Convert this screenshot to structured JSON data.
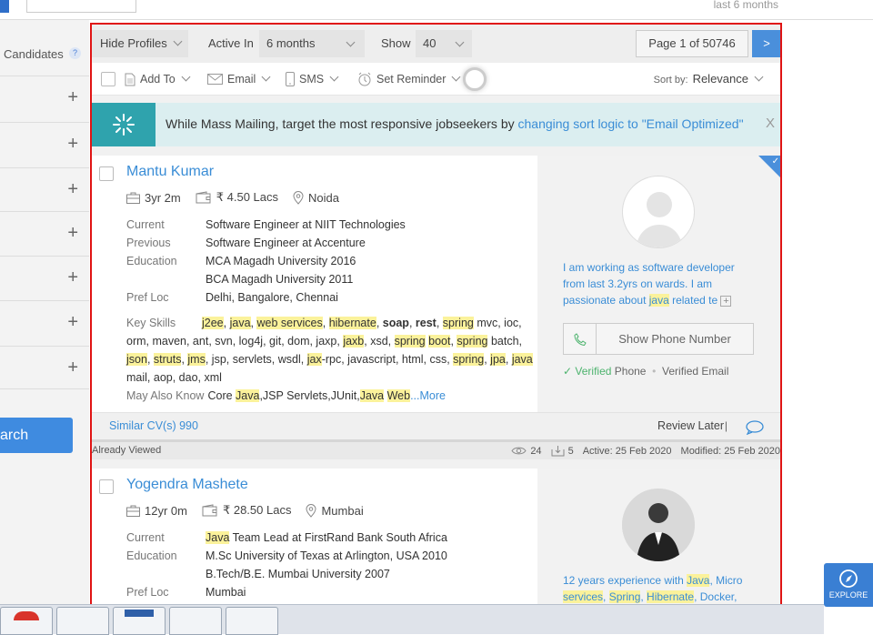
{
  "topbar": {
    "last_label": "last 6 months"
  },
  "sidebar": {
    "candidates_label": "Candidates",
    "help_glyph": "?",
    "rows": [
      "+",
      "+",
      "+",
      "+",
      "+",
      "+",
      "+"
    ],
    "search_label": "arch"
  },
  "filters": {
    "hide_profiles": "Hide Profiles",
    "active_in_label": "Active In",
    "active_in_value": "6 months",
    "show_label": "Show",
    "show_value": "40",
    "page_info": "Page 1 of 50746",
    "next_label": ">"
  },
  "actions": {
    "add_to": "Add To",
    "email": "Email",
    "sms": "SMS",
    "set_reminder": "Set Reminder",
    "sort_by_label": "Sort by:",
    "sort_by_value": "Relevance"
  },
  "banner": {
    "text": "While Mass Mailing, target the most responsive jobseekers by ",
    "link": "changing sort logic to \"Email Optimized\"",
    "close": "X"
  },
  "candidates": [
    {
      "name": "Mantu Kumar",
      "experience": "3yr 2m",
      "salary": "₹ 4.50 Lacs",
      "location": "Noida",
      "current_label": "Current",
      "current": "Software Engineer at NIIT Technologies",
      "previous_label": "Previous",
      "previous": "Software Engineer at Accenture",
      "education_label": "Education",
      "education_1": "MCA Magadh University 2016",
      "education_2": "BCA Magadh University 2011",
      "pref_loc_label": "Pref Loc",
      "pref_loc": "Delhi, Bangalore, Chennai",
      "key_skills_label": "Key Skills",
      "may_also_know_label": "May Also Know",
      "may_also_know_pre": "Core ",
      "may_also_know_hl1": "Java",
      "may_also_know_mid": ",JSP Servlets,JUnit,",
      "may_also_know_hl2": "Java",
      "may_also_know_sp": " ",
      "may_also_know_hl3": "Web",
      "more_label": "...More",
      "summary_1": "I am working as software developer from last 3.2yrs on wards. I am passionate about ",
      "summary_hl": "java",
      "summary_2": " related te",
      "summary_more": "+",
      "show_phone": "Show Phone Number",
      "verified_phone": "Verified",
      "phone_word": "Phone",
      "verified_email": "Verified Email",
      "similar": "Similar CV(s) 990",
      "review_later": "Review Later",
      "review_sep": "|",
      "already_viewed": "Already Viewed",
      "views": "24",
      "downloads": "5",
      "active": "Active: 25 Feb 2020",
      "modified": "Modified: 25 Feb 2020"
    },
    {
      "name": "Yogendra Mashete",
      "experience": "12yr 0m",
      "salary": "₹ 28.50 Lacs",
      "location": "Mumbai",
      "current_label": "Current",
      "current_hl": "Java",
      "current_rest": " Team Lead at FirstRand Bank South Africa",
      "education_label": "Education",
      "education_1": "M.Sc University of Texas at Arlington, USA 2010",
      "education_2": "B.Tech/B.E. Mumbai University 2007",
      "pref_loc_label": "Pref Loc",
      "pref_loc": "Mumbai",
      "summary_1": "12 years experience with ",
      "summary_hl1": "Java",
      "summary_2": ", Micro ",
      "summary_hl2": "services",
      "summary_3": ", ",
      "summary_hl3": "Spring",
      "summary_4": ", ",
      "summary_hl4": "Hibernate",
      "summary_5": ", Docker,"
    }
  ],
  "skills_tokens": [
    {
      "t": "j2ee",
      "h": true
    },
    {
      "t": ", "
    },
    {
      "t": "java",
      "h": true
    },
    {
      "t": ", "
    },
    {
      "t": "web services",
      "h": true
    },
    {
      "t": ", "
    },
    {
      "t": "hibernate",
      "h": true
    },
    {
      "t": ", "
    },
    {
      "t": "soap",
      "b": true
    },
    {
      "t": ", "
    },
    {
      "t": "rest",
      "b": true
    },
    {
      "t": ", "
    },
    {
      "t": "spring",
      "h": true
    },
    {
      "t": " mvc, ioc, orm, maven, ant, svn, log4j, git, dom, jaxp, "
    },
    {
      "t": "jaxb",
      "h": true
    },
    {
      "t": ", xsd, "
    },
    {
      "t": "spring",
      "h": true
    },
    {
      "t": " "
    },
    {
      "t": "boot",
      "h": true
    },
    {
      "t": ", "
    },
    {
      "t": "spring",
      "h": true
    },
    {
      "t": " batch, "
    },
    {
      "t": "json",
      "h": true
    },
    {
      "t": ", "
    },
    {
      "t": "struts",
      "h": true
    },
    {
      "t": ", "
    },
    {
      "t": "jms",
      "h": true
    },
    {
      "t": ", jsp, servlets, wsdl, "
    },
    {
      "t": "jax",
      "h": true
    },
    {
      "t": "-rpc, javascript, html, css, "
    },
    {
      "t": "spring",
      "h": true
    },
    {
      "t": ", "
    },
    {
      "t": "jpa",
      "h": true
    },
    {
      "t": ", "
    },
    {
      "t": "java",
      "h": true
    },
    {
      "t": " mail, aop, dao, xml"
    }
  ],
  "explore_label": "EXPLORE",
  "colors": {
    "accent": "#3a8dd6",
    "frame": "#e01414",
    "banner_icon": "#2fa3ad",
    "highlight": "#fbf29b"
  }
}
